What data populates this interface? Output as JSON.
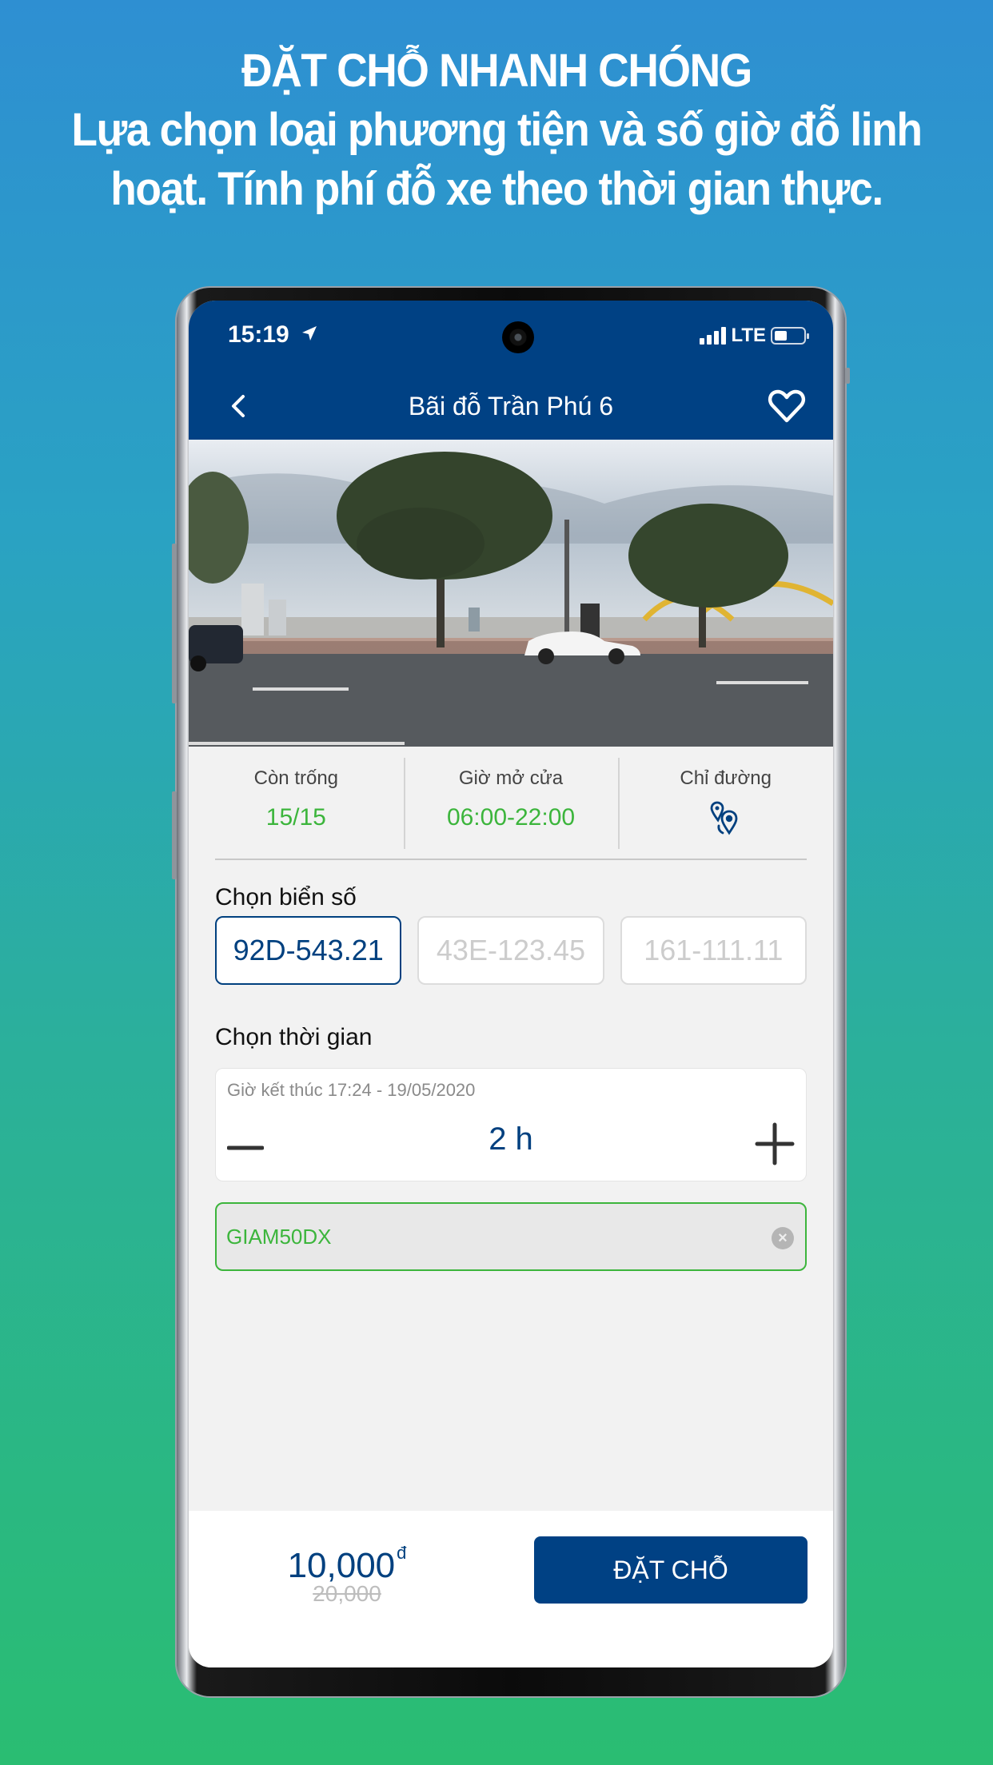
{
  "headline": {
    "title": "ĐẶT CHỖ NHANH CHÓNG",
    "line1": "Lựa chọn loại phương tiện và số giờ đỗ linh",
    "line2": "hoạt. Tính phí đỗ xe theo thời gian thực."
  },
  "status_bar": {
    "time": "15:19",
    "network": "LTE",
    "battery_level": 0.45
  },
  "nav": {
    "title": "Bãi đỗ Trần Phú 6",
    "back_icon": "chevron-left-icon",
    "favorite_icon": "heart-icon"
  },
  "hero_image": {
    "description": "street view of riverside parking along Trần Phú with trees, cars and dragon bridge"
  },
  "info": [
    {
      "label": "Còn trống",
      "value": "15/15"
    },
    {
      "label": "Giờ mở cửa",
      "value": "06:00-22:00"
    },
    {
      "label": "Chỉ đường",
      "icon": "directions-pin-icon"
    }
  ],
  "plates": {
    "label": "Chọn biển số",
    "options": [
      "92D-543.21",
      "43E-123.45",
      "161-111.11"
    ],
    "selected_index": 0
  },
  "time": {
    "label": "Chọn thời gian",
    "end_time": "Giờ kết thúc 17:24 - 19/05/2020",
    "duration": "2 h"
  },
  "promo": {
    "code": "GIAM50DX",
    "clear_icon": "close-circle-icon"
  },
  "checkout": {
    "price": "10,000",
    "currency": "đ",
    "original_price": "20,000",
    "book_label": "ĐẶT CHỖ"
  },
  "colors": {
    "brand": "#004184",
    "success": "#3cb53c",
    "muted": "#bdbdbd"
  }
}
